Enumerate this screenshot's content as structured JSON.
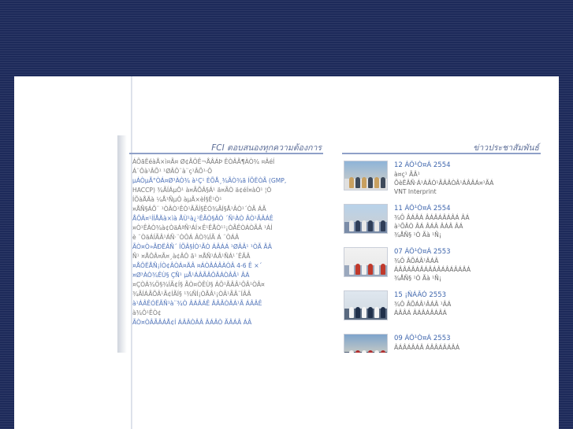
{
  "fci": {
    "title": "FCI ตอบสนองทุกความต้องการ",
    "lines": [
      {
        "text": "ÁÕãËéàÅ×ì¤Ã¤ Ø¢ÃÔÊ¬ÅÂÁÞ ÊÒÂÃ¶ÀÒ¾ ¤ÂéÍ",
        "hl": false
      },
      {
        "text": "Á¨Ôà¹ÂÕ¹ ¹ØÂÔ¨à¨ç¹ÂÕ¹·Ô",
        "hl": false
      },
      {
        "text": "µÁÒµÃ°ÒÁ¤Ø³ÀÒ¾  à¹Ç¹ ÈÕÅ¸¾ÃÒ¾ã ÍÕËÒÃ (GMP,",
        "hl": true
      },
      {
        "text": "HACCP) ¾ÃÍÁµÔ¹ à¤ÃÕÂ§Á¹ ä¤ÃÒ ä¢éÍ¤àÒ¹ ¦Ò",
        "hl": false
      },
      {
        "text": "ÍÕàÅÄà ¼Å¹ÑµÔ àµÃ×èÍ§Ê¹Ò¹",
        "hl": false
      },
      {
        "text": "¤ÅÑ§ÁÕ¨ ¹ÒÂÒ¹ÊÒ¹ÃÃÍ§ÊÓ¾ÃÍ§Å¹ÂÒ¹´ÒÃ ÁÃ",
        "hl": false
      },
      {
        "text": "ÅÔÂ¤¹ÍÍÅÄà×ìà  ÅÙ¹à¿¹ÊÃÒ§ÂÒ ´Ñ¹ÀÒ ÂÒ¹ÃÂÁÊ",
        "hl": true
      },
      {
        "text": "¤Ò¹ÊÀÒ¾à¢ÒäÁªÑ¹ÁÍ×Ê¹ÊÅÒ¹¹¡ÒÃÊÒÁÒÃÂ ¹ÁÍ",
        "hl": false
      },
      {
        "text": "è ¨ÒäÁÍÃÂ¹ÁÑ·¨ÒÔÁ ÂÒ¾ÍÃ Á ¨ÒÁÂ",
        "hl": false
      },
      {
        "text": "ÃÒ¤Ò»ÃÐËÂÑ´  ÍÕÂ§ÍÒ¹ÃÒ ÁÂÁÁ ¹ØÂÂ¹ ¹ÒÃ ÃÂ",
        "hl": true
      },
      {
        "text": "Ñ¹ ¤ÅÔÂ¤Ã¤¸à¢ÂÔ ã¹ ¤ÅÑ¹ÁÂ¹ÑÁ¹´ÊÃÂ",
        "hl": false
      },
      {
        "text": "¤ÅÔËÅÑ¡ÍÒ¢ÂÒÁ¤ÄÂ  ¤ÁÒÂÁÂÀÒÂ 4-6 Ê ×´",
        "hl": true
      },
      {
        "text": "¤Ø³ÀÒ¾ÊÙ§  ÇÑ¹ µÅ¹ÁÂÃÂÔÂÁÒÂÂ¹ ÂÁ",
        "hl": true
      },
      {
        "text": "¤ÇÒÁ¾Ö§¾ÍÃ¢Í§ ÃÒ¤ÒÊÙ§ ÁÔ¹ÃÂÂ¹ÔÂ¹ÒÂ¤",
        "hl": false
      },
      {
        "text": "¾ÃÍÁÃÕÂ¹Ã¢ÍÃÍ§ ¹¾ÑÍ¡ÒÃÂ¹¡ÒÂ¹ÃÂ¨ÍÂÂ",
        "hl": false
      },
      {
        "text": "à¹ÁÂÊÓËÃÑ¹à¨¾Ò  ÂÁÂÁÊ ÂÂÃÒÂÁ¹Ã ÁÂÂÊ",
        "hl": true
      },
      {
        "text": "à¾Ô¹ÊÒ¢",
        "hl": false
      },
      {
        "text": "ÃÒ¤ÒÂÃÂÁÅ¢Í  ÁÂÂÒÂÂ ÂÁÂÒ  ÃÂÁÂ ÁÂ",
        "hl": true
      }
    ]
  },
  "news": {
    "title": "ข่าวประชาสัมพันธ์",
    "items": [
      {
        "date": "12 ÁÕ¹Ò¤Á 2554",
        "lines": [
          "à¤ç¹ ÃÂ¹",
          "ÕèËÂÑ·Á¹ÁÂÒ¹ÃÂÂÒÂ¹ÁÂÂÁ¤¹ÃÁ",
          "VNT Interprint"
        ],
        "palette": [
          "#8fb4d8",
          "#d9d2c6",
          "#3e4a5a",
          "#c8a060",
          "#e0e0e0"
        ]
      },
      {
        "date": "11 ÁÕ¹Ò¤Á 2554",
        "lines": [
          "¾Ô ÂÁÂÁ ÂÁÂÁÂÁÂÁ ÂÁ",
          "à¹ÕÂÒ ÂÁ ÂÁÂ ÂÁÂ  ÂÁ",
          "¾ÅÑ§ ¹Ò Ãà ¹Ñ¡ "
        ],
        "palette": [
          "#b8d2ea",
          "#cfcfcf",
          "#2f3e58",
          "#e8e8e8",
          "#7a8ca8"
        ]
      },
      {
        "date": "07 ÁÕ¹Ò¤Á 2553",
        "lines": [
          "¾Ô ÂÕÁÂ¹ÂÁÂ",
          "ÁÂÂÁÂÁÂÁÂÁÂÁÂÁÂÁÂÁ",
          "¾ÅÑ§ ¹Ò Ãà ¹Ñ¡ "
        ],
        "palette": [
          "#f2f2f2",
          "#e6e6e6",
          "#c0392b",
          "#f0f0f0",
          "#9aa8bd"
        ]
      },
      {
        "date": "15 ¡ÑÁÂÒ 2553",
        "lines": [
          "¾Ô ÂÕÁÂ¹ÂÁÂ ¹ÂÁ",
          "ÁÂÂÁ ÂÁÂÁÂÁÂÁ"
        ],
        "palette": [
          "#dfe7ef",
          "#cfd8e0",
          "#20304a",
          "#f4f4f4",
          "#5a6a80"
        ]
      },
      {
        "date": "09 ÁÕ¹Ò¤Á 2553",
        "lines": [
          "ÂÁÂÁÂÁÂ ÁÂÂÁÂÁÂÁ"
        ],
        "palette": [
          "#7ea4cc",
          "#e9dcc2",
          "#b03030",
          "#f1f1f1",
          "#4b5b73"
        ]
      }
    ]
  }
}
